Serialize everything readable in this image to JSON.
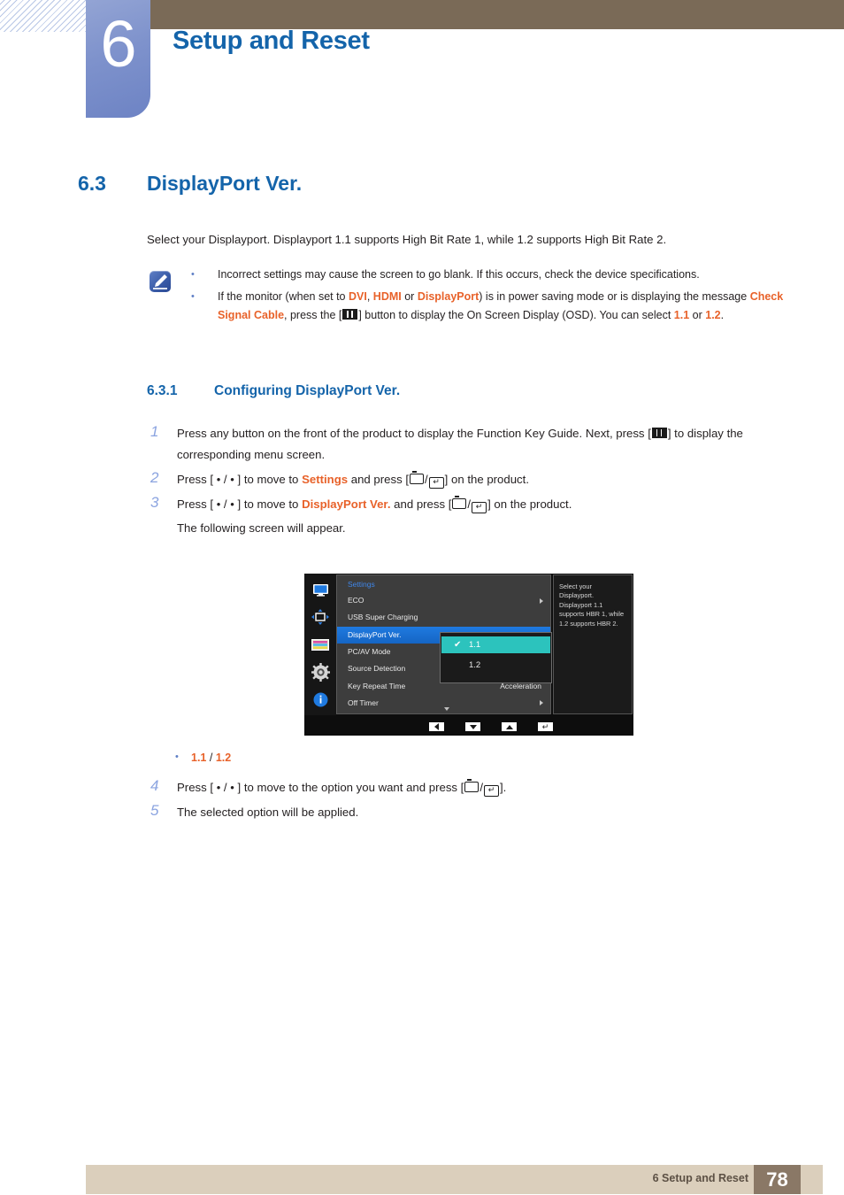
{
  "header": {
    "chapter_number": "6",
    "chapter_title": "Setup and Reset"
  },
  "section": {
    "number": "6.3",
    "title": "DisplayPort Ver.",
    "intro": "Select your Displayport. Displayport 1.1 supports High Bit Rate 1, while 1.2 supports High Bit Rate 2."
  },
  "note": {
    "icon": "note-pencil-icon",
    "bullets": [
      {
        "parts": [
          {
            "t": "Incorrect settings may cause the screen to go blank. If this occurs, check the device specifications.",
            "style": "plain"
          }
        ]
      },
      {
        "parts": [
          {
            "t": "If the monitor (when set to ",
            "style": "plain"
          },
          {
            "t": "DVI",
            "style": "orange"
          },
          {
            "t": ", ",
            "style": "plain"
          },
          {
            "t": "HDMI",
            "style": "orange"
          },
          {
            "t": " or ",
            "style": "plain"
          },
          {
            "t": "DisplayPort",
            "style": "orange"
          },
          {
            "t": ") is in power saving mode or is displaying the message ",
            "style": "plain"
          },
          {
            "t": "Check Signal Cable",
            "style": "orange"
          },
          {
            "t": ", press the [",
            "style": "plain"
          },
          {
            "t": "",
            "style": "key-menu"
          },
          {
            "t": "] button to display the On Screen Display (OSD). You can select ",
            "style": "plain"
          },
          {
            "t": "1.1",
            "style": "orange"
          },
          {
            "t": " or ",
            "style": "plain"
          },
          {
            "t": "1.2",
            "style": "orange"
          },
          {
            "t": ".",
            "style": "plain"
          }
        ]
      }
    ]
  },
  "subsection": {
    "number": "6.3.1",
    "title": "Configuring DisplayPort Ver."
  },
  "steps": [
    {
      "num": "1",
      "parts": [
        {
          "t": "Press any button on the front of the product to display the Function Key Guide. Next, press [",
          "style": "plain"
        },
        {
          "t": "",
          "style": "key-menu"
        },
        {
          "t": "] to display the corresponding menu screen.",
          "style": "plain"
        }
      ]
    },
    {
      "num": "2",
      "parts": [
        {
          "t": "Press [ ",
          "style": "plain"
        },
        {
          "t": "•",
          "style": "dotkey"
        },
        {
          "t": " / ",
          "style": "plain"
        },
        {
          "t": "•",
          "style": "dotkey"
        },
        {
          "t": " ] to move to ",
          "style": "plain"
        },
        {
          "t": "Settings",
          "style": "orange"
        },
        {
          "t": " and press [",
          "style": "plain"
        },
        {
          "t": "",
          "style": "key-back"
        },
        {
          "t": "/",
          "style": "plain"
        },
        {
          "t": "",
          "style": "key-enter"
        },
        {
          "t": "] on the product.",
          "style": "plain"
        }
      ]
    },
    {
      "num": "3",
      "parts": [
        {
          "t": "Press [ ",
          "style": "plain"
        },
        {
          "t": "•",
          "style": "dotkey"
        },
        {
          "t": " / ",
          "style": "plain"
        },
        {
          "t": "•",
          "style": "dotkey"
        },
        {
          "t": " ] to move to ",
          "style": "plain"
        },
        {
          "t": "DisplayPort Ver.",
          "style": "orange"
        },
        {
          "t": " and press [",
          "style": "plain"
        },
        {
          "t": "",
          "style": "key-back"
        },
        {
          "t": "/",
          "style": "plain"
        },
        {
          "t": "",
          "style": "key-enter"
        },
        {
          "t": "] on the product.",
          "style": "plain"
        }
      ],
      "sub": "The following screen will appear."
    }
  ],
  "option_bullet": {
    "option_a": "1.1",
    "separator": " / ",
    "option_b": "1.2"
  },
  "steps2": [
    {
      "num": "4",
      "parts": [
        {
          "t": "Press [ ",
          "style": "plain"
        },
        {
          "t": "•",
          "style": "dotkey"
        },
        {
          "t": " / ",
          "style": "plain"
        },
        {
          "t": "•",
          "style": "dotkey"
        },
        {
          "t": " ] to move to the option you want and press [",
          "style": "plain"
        },
        {
          "t": "",
          "style": "key-back"
        },
        {
          "t": "/",
          "style": "plain"
        },
        {
          "t": "",
          "style": "key-enter"
        },
        {
          "t": "].",
          "style": "plain"
        }
      ]
    },
    {
      "num": "5",
      "parts": [
        {
          "t": "The selected option will be applied.",
          "style": "plain"
        }
      ]
    }
  ],
  "osd": {
    "title": "Settings",
    "side_icons": [
      "monitor-icon",
      "picture-size-icon",
      "pip-icon",
      "gear-icon",
      "info-icon"
    ],
    "rows": [
      {
        "label": "ECO",
        "value": "",
        "arrow": true,
        "selected": false
      },
      {
        "label": "USB Super Charging",
        "value": "",
        "arrow": false,
        "selected": false
      },
      {
        "label": "DisplayPort Ver.",
        "value": "",
        "arrow": false,
        "selected": true
      },
      {
        "label": "PC/AV Mode",
        "value": "",
        "arrow": false,
        "selected": false
      },
      {
        "label": "Source Detection",
        "value": "",
        "arrow": false,
        "selected": false
      },
      {
        "label": "Key Repeat Time",
        "value": "Acceleration",
        "arrow": false,
        "selected": false
      },
      {
        "label": "Off Timer",
        "value": "",
        "arrow": true,
        "selected": false
      }
    ],
    "submenu": {
      "options": [
        {
          "label": "1.1",
          "checked": true
        },
        {
          "label": "1.2",
          "checked": false
        }
      ]
    },
    "description": "Select your Displayport. Displayport 1.1 supports HBR 1, while 1.2 supports HBR 2.",
    "footer_buttons": [
      "back-arrow-button",
      "down-arrow-button",
      "up-arrow-button",
      "enter-button"
    ],
    "colors": {
      "selected_row": "#1f7ae0",
      "selected_option": "#2cc3bd",
      "menu_bg": "#3d3d3d",
      "panel_bg": "#1b1b1b",
      "title": "#3f86e8"
    }
  },
  "footer": {
    "text": "6 Setup and Reset",
    "page": "78"
  },
  "theme": {
    "heading_blue": "#1464aa",
    "accent_orange": "#e8622a",
    "header_brown": "#7a6a57",
    "footer_tan": "#dbcfbc",
    "page_box_brown": "#8a7866",
    "step_number_blue": "#8ba4e0"
  }
}
